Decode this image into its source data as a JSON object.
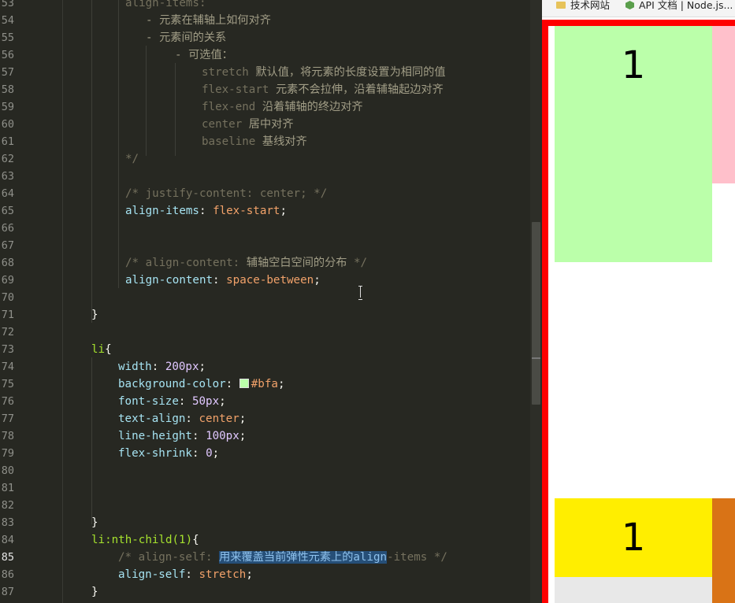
{
  "editor": {
    "current_line": 85,
    "lines": [
      {
        "n": 53,
        "indent": 159,
        "tokens": [
          {
            "t": "align-items:",
            "c": "c"
          }
        ]
      },
      {
        "n": 54,
        "indent": 185,
        "tokens": [
          {
            "t": "- 元素在辅轴上如何对齐",
            "c": "cz"
          }
        ]
      },
      {
        "n": 55,
        "indent": 185,
        "tokens": [
          {
            "t": "- 元素间的关系",
            "c": "cz"
          }
        ]
      },
      {
        "n": 56,
        "indent": 222,
        "tokens": [
          {
            "t": "- 可选值：",
            "c": "cz"
          }
        ]
      },
      {
        "n": 57,
        "indent": 256,
        "tokens": [
          {
            "t": "stretch ",
            "c": "c"
          },
          {
            "t": "默认值，将元素的长度设置为相同的值",
            "c": "cz"
          }
        ]
      },
      {
        "n": 58,
        "indent": 256,
        "tokens": [
          {
            "t": "flex-start ",
            "c": "c"
          },
          {
            "t": "元素不会拉伸，沿着辅轴起边对齐",
            "c": "cz"
          }
        ]
      },
      {
        "n": 59,
        "indent": 256,
        "tokens": [
          {
            "t": "flex-end ",
            "c": "c"
          },
          {
            "t": "沿着辅轴的终边对齐",
            "c": "cz"
          }
        ]
      },
      {
        "n": 60,
        "indent": 256,
        "tokens": [
          {
            "t": "center ",
            "c": "c"
          },
          {
            "t": "居中对齐",
            "c": "cz"
          }
        ]
      },
      {
        "n": 61,
        "indent": 256,
        "tokens": [
          {
            "t": "baseline ",
            "c": "c"
          },
          {
            "t": "基线对齐",
            "c": "cz"
          }
        ]
      },
      {
        "n": 62,
        "indent": 159,
        "tokens": [
          {
            "t": "*/",
            "c": "c"
          }
        ]
      },
      {
        "n": 63,
        "indent": 159,
        "tokens": []
      },
      {
        "n": 64,
        "indent": 159,
        "tokens": [
          {
            "t": "/* justify-content: center; */",
            "c": "c"
          }
        ]
      },
      {
        "n": 65,
        "indent": 159,
        "tokens": [
          {
            "t": "align-items",
            "c": "p"
          },
          {
            "t": ": ",
            "c": "pl"
          },
          {
            "t": "flex-start",
            "c": "v"
          },
          {
            "t": ";",
            "c": "pl"
          }
        ]
      },
      {
        "n": 66,
        "indent": 159,
        "tokens": []
      },
      {
        "n": 67,
        "indent": 159,
        "tokens": []
      },
      {
        "n": 68,
        "indent": 159,
        "tokens": [
          {
            "t": "/* align-content: ",
            "c": "c"
          },
          {
            "t": "辅轴空白空间的分布",
            "c": "cz"
          },
          {
            "t": " */",
            "c": "c"
          }
        ]
      },
      {
        "n": 69,
        "indent": 159,
        "tokens": [
          {
            "t": "align-content",
            "c": "p"
          },
          {
            "t": ": ",
            "c": "pl"
          },
          {
            "t": "space-between",
            "c": "v"
          },
          {
            "t": ";",
            "c": "pl"
          }
        ]
      },
      {
        "n": 70,
        "indent": 159,
        "tokens": []
      },
      {
        "n": 71,
        "indent": 116,
        "tokens": [
          {
            "t": "}",
            "c": "pl"
          }
        ]
      },
      {
        "n": 72,
        "indent": 116,
        "tokens": []
      },
      {
        "n": 73,
        "indent": 116,
        "tokens": [
          {
            "t": "li",
            "c": "s"
          },
          {
            "t": "{",
            "c": "pl"
          }
        ]
      },
      {
        "n": 74,
        "indent": 150,
        "tokens": [
          {
            "t": "width",
            "c": "p"
          },
          {
            "t": ": ",
            "c": "pl"
          },
          {
            "t": "200px",
            "c": "n"
          },
          {
            "t": ";",
            "c": "pl"
          }
        ]
      },
      {
        "n": 75,
        "indent": 150,
        "tokens": [
          {
            "t": "background-color",
            "c": "p"
          },
          {
            "t": ": ",
            "c": "pl"
          },
          {
            "t": "#bfa",
            "c": "v",
            "swatch": true
          },
          {
            "t": ";",
            "c": "pl"
          }
        ]
      },
      {
        "n": 76,
        "indent": 150,
        "tokens": [
          {
            "t": "font-size",
            "c": "p"
          },
          {
            "t": ": ",
            "c": "pl"
          },
          {
            "t": "50px",
            "c": "n"
          },
          {
            "t": ";",
            "c": "pl"
          }
        ]
      },
      {
        "n": 77,
        "indent": 150,
        "tokens": [
          {
            "t": "text-align",
            "c": "p"
          },
          {
            "t": ": ",
            "c": "pl"
          },
          {
            "t": "center",
            "c": "v"
          },
          {
            "t": ";",
            "c": "pl"
          }
        ]
      },
      {
        "n": 78,
        "indent": 150,
        "tokens": [
          {
            "t": "line-height",
            "c": "p"
          },
          {
            "t": ": ",
            "c": "pl"
          },
          {
            "t": "100px",
            "c": "n"
          },
          {
            "t": ";",
            "c": "pl"
          }
        ]
      },
      {
        "n": 79,
        "indent": 150,
        "tokens": [
          {
            "t": "flex-shrink",
            "c": "p"
          },
          {
            "t": ": ",
            "c": "pl"
          },
          {
            "t": "0",
            "c": "n"
          },
          {
            "t": ";",
            "c": "pl"
          }
        ]
      },
      {
        "n": 80,
        "indent": 150,
        "tokens": []
      },
      {
        "n": 81,
        "indent": 150,
        "tokens": []
      },
      {
        "n": 82,
        "indent": 150,
        "tokens": []
      },
      {
        "n": 83,
        "indent": 116,
        "tokens": [
          {
            "t": "}",
            "c": "pl"
          }
        ]
      },
      {
        "n": 84,
        "indent": 116,
        "tokens": [
          {
            "t": "li:nth-child(1)",
            "c": "s"
          },
          {
            "t": "{",
            "c": "pl"
          }
        ]
      },
      {
        "n": 85,
        "indent": 150,
        "tokens": [
          {
            "t": "/* align-self: ",
            "c": "c"
          },
          {
            "t": "用来覆盖当前弹性元素上的align",
            "c": "hl"
          },
          {
            "t": "-items */",
            "c": "c"
          }
        ]
      },
      {
        "n": 86,
        "indent": 150,
        "tokens": [
          {
            "t": "align-self",
            "c": "p"
          },
          {
            "t": ": ",
            "c": "pl"
          },
          {
            "t": "stretch",
            "c": "v"
          },
          {
            "t": ";",
            "c": "pl"
          }
        ]
      },
      {
        "n": 87,
        "indent": 116,
        "tokens": [
          {
            "t": "}",
            "c": "pl"
          }
        ]
      }
    ]
  },
  "browser": {
    "bookmarks": [
      {
        "label": "技术网站",
        "icon": "folder-icon"
      },
      {
        "label": "API 文档 | Node.js...",
        "icon": "node-icon"
      }
    ],
    "items": [
      {
        "text": "1",
        "color": "#bbffaa"
      },
      {
        "text": "",
        "color": "#ffc0cb"
      },
      {
        "text": "1",
        "color": "#ffee00"
      },
      {
        "text": "",
        "color": "#d97316"
      }
    ],
    "container_border": "#ff0000"
  }
}
